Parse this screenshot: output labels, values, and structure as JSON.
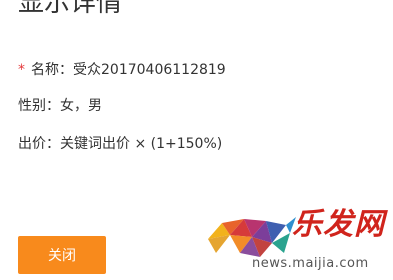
{
  "title": "显示详情",
  "detail": {
    "name_required_mark": "*",
    "name_label": "名称：",
    "name_value": "受众20170406112819",
    "gender_label": "性别：",
    "gender_value": "女，男",
    "bid_label": "出价：",
    "bid_value": "关键词出价 × (1+150%)"
  },
  "footer": {
    "close_label": "关闭"
  },
  "watermark": {
    "brand": "乐发网",
    "url": "news.maijia.com"
  },
  "colors": {
    "button_bg": "#f88a1c",
    "required_mark": "#e4393c",
    "watermark_brand": "#d0241c"
  }
}
